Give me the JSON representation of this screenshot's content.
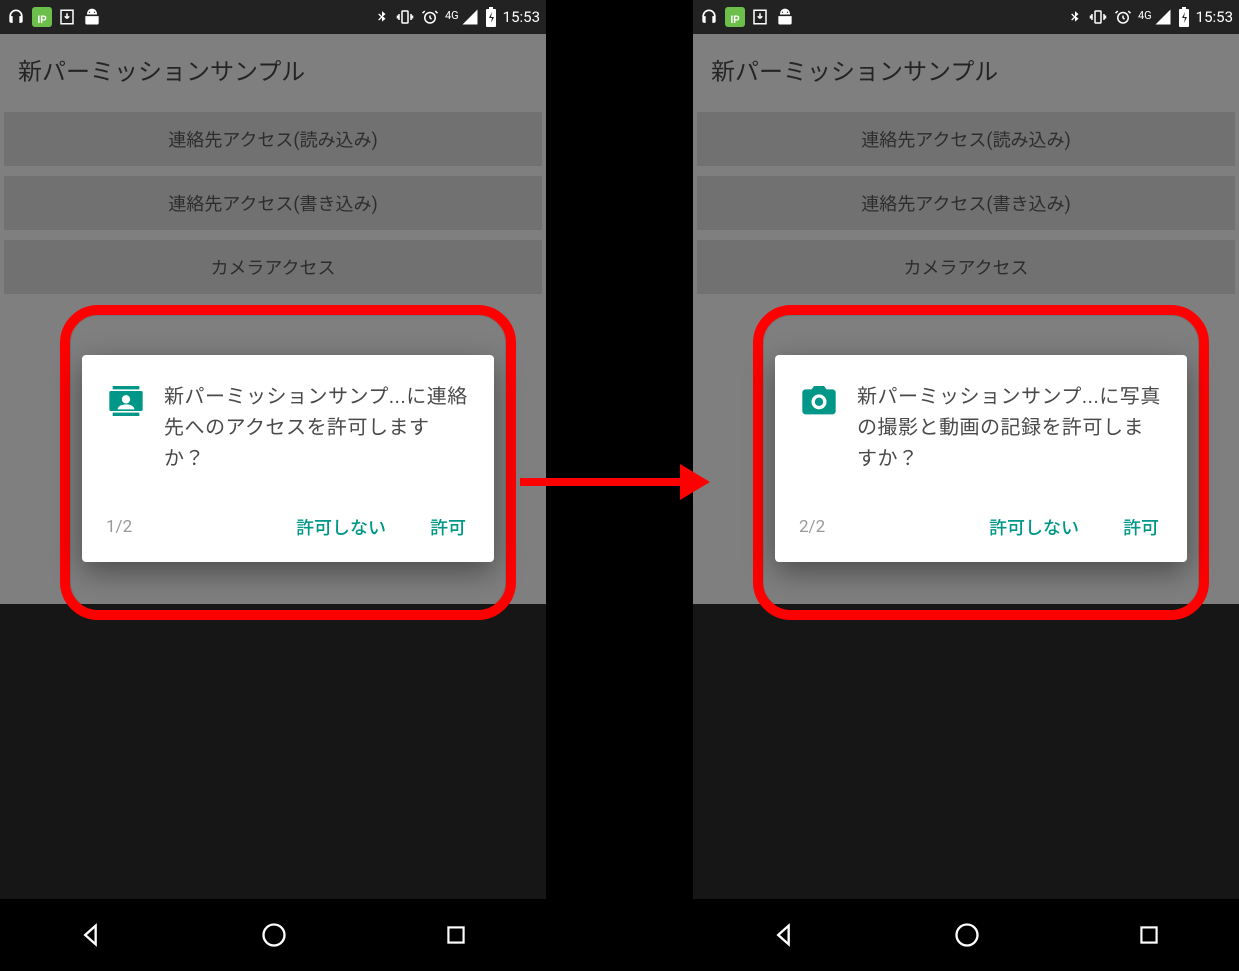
{
  "status": {
    "time": "15:53",
    "network_label": "4G"
  },
  "app": {
    "title": "新パーミッションサンプル",
    "buttons": {
      "contacts_read": "連絡先アクセス(読み込み)",
      "contacts_write": "連絡先アクセス(書き込み)",
      "camera": "カメラアクセス"
    }
  },
  "dialogs": {
    "left": {
      "message": "新パーミッションサンプ...に連絡先へのアクセスを許可しますか？",
      "counter": "1/2",
      "deny": "許可しない",
      "allow": "許可"
    },
    "right": {
      "message": "新パーミッションサンプ...に写真の撮影と動画の記録を許可しますか？",
      "counter": "2/2",
      "deny": "許可しない",
      "allow": "許可"
    }
  },
  "colors": {
    "accent": "#009688",
    "highlight": "#ff0000"
  }
}
